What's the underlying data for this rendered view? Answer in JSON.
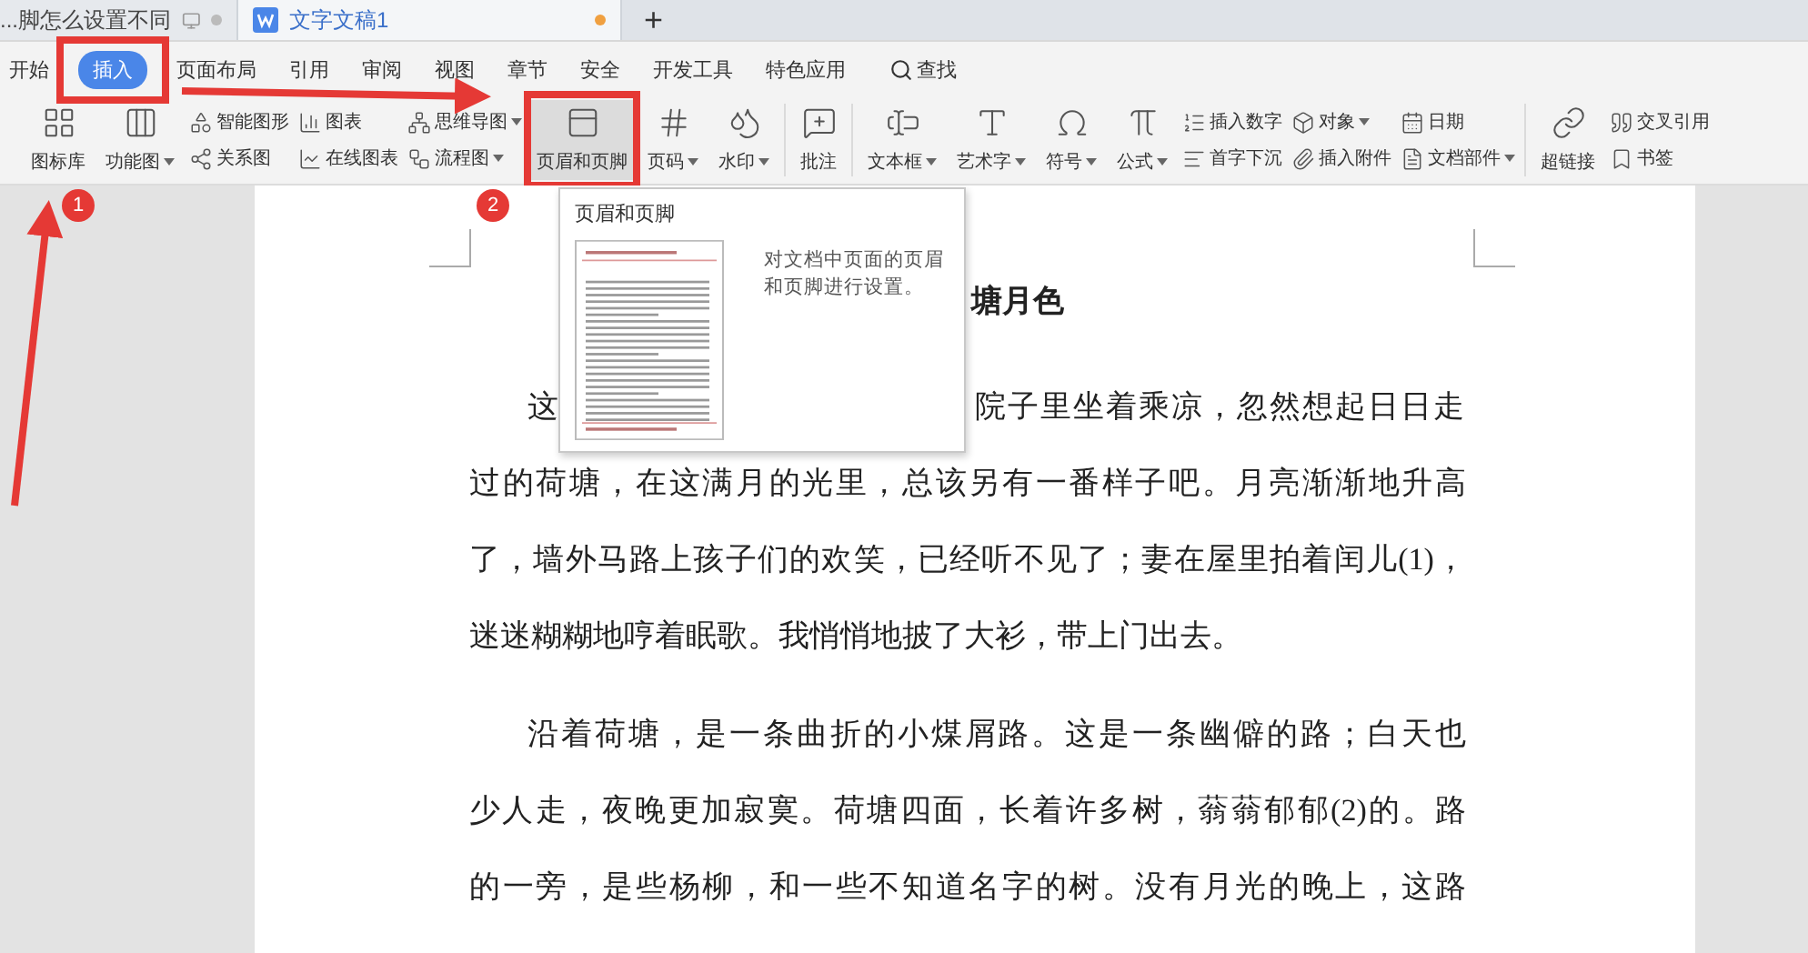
{
  "doc_tabs": [
    {
      "title": "...脚怎么设置不同",
      "selected": false,
      "modified": false
    },
    {
      "title": "文字文稿1",
      "selected": true,
      "modified": true
    }
  ],
  "new_tab": "+",
  "menu": [
    {
      "label": "开始",
      "selected": false
    },
    {
      "label": "插入",
      "selected": true
    },
    {
      "label": "页面布局",
      "selected": false
    },
    {
      "label": "引用",
      "selected": false
    },
    {
      "label": "审阅",
      "selected": false
    },
    {
      "label": "视图",
      "selected": false
    },
    {
      "label": "章节",
      "selected": false
    },
    {
      "label": "安全",
      "selected": false
    },
    {
      "label": "开发工具",
      "selected": false
    },
    {
      "label": "特色应用",
      "selected": false
    }
  ],
  "search": "查找",
  "ribbon": [
    {
      "kind": "large",
      "label": "图标库",
      "dropdown": false,
      "selected": false
    },
    {
      "kind": "large",
      "label": "功能图",
      "dropdown": true,
      "selected": false
    },
    {
      "kind": "stack",
      "items": [
        {
          "label": "智能图形",
          "dropdown": false
        },
        {
          "label": "关系图",
          "dropdown": false
        }
      ]
    },
    {
      "kind": "stack",
      "items": [
        {
          "label": "图表",
          "dropdown": false
        },
        {
          "label": "在线图表",
          "dropdown": false
        }
      ]
    },
    {
      "kind": "stack",
      "items": [
        {
          "label": "思维导图",
          "dropdown": true
        },
        {
          "label": "流程图",
          "dropdown": true
        }
      ]
    },
    {
      "kind": "large",
      "label": "页眉和页脚",
      "dropdown": false,
      "selected": true
    },
    {
      "kind": "large",
      "label": "页码",
      "dropdown": true,
      "selected": false
    },
    {
      "kind": "large",
      "label": "水印",
      "dropdown": true,
      "selected": false
    },
    {
      "kind": "large",
      "label": "批注",
      "dropdown": false,
      "selected": false
    },
    {
      "kind": "large",
      "label": "文本框",
      "dropdown": true,
      "selected": false
    },
    {
      "kind": "large",
      "label": "艺术字",
      "dropdown": true,
      "selected": false
    },
    {
      "kind": "large",
      "label": "符号",
      "dropdown": true,
      "selected": false
    },
    {
      "kind": "large",
      "label": "公式",
      "dropdown": true,
      "selected": false
    },
    {
      "kind": "stack",
      "items": [
        {
          "label": "插入数字",
          "dropdown": false
        },
        {
          "label": "首字下沉",
          "dropdown": false
        }
      ]
    },
    {
      "kind": "stack",
      "items": [
        {
          "label": "对象",
          "dropdown": true
        },
        {
          "label": "插入附件",
          "dropdown": false
        }
      ]
    },
    {
      "kind": "stack",
      "items": [
        {
          "label": "日期",
          "dropdown": false
        },
        {
          "label": "文档部件",
          "dropdown": true
        }
      ]
    },
    {
      "kind": "large",
      "label": "超链接",
      "dropdown": false,
      "selected": false
    },
    {
      "kind": "stack",
      "items": [
        {
          "label": "交叉引用",
          "dropdown": false
        },
        {
          "label": "书签",
          "dropdown": false
        }
      ]
    }
  ],
  "tooltip": {
    "title": "页眉和页脚",
    "description": "对文档中页面的页眉和页脚进行设置。"
  },
  "document": {
    "title": "塘月色",
    "paragraphs": [
      {
        "lines": [
          [
            "这",
            "院子里坐着乘凉，忽然想起日日走"
          ],
          [
            "过的荷塘，在这满月的光里，总该另有一番样子吧。月亮渐渐地升高"
          ],
          [
            "了，墙外马路上孩子们的欢笑，已经听不见了；妻在屋里拍着闰儿(1)，"
          ],
          [
            "迷迷糊糊地哼着眠歌。我悄悄地披了大衫，带上门出去。"
          ]
        ]
      },
      {
        "lines": [
          [
            "沿着荷塘，是一条曲折的小煤屑路。这是一条幽僻的路；白天也"
          ],
          [
            "少人走，夜晚更加寂寞。荷塘四面，长着许多树，蓊蓊郁郁(2)的。路"
          ],
          [
            "的一旁，是些杨柳，和一些不知道名字的树。没有月光的晚上，这路"
          ]
        ]
      }
    ]
  },
  "annotations": [
    {
      "label": "1"
    },
    {
      "label": "2"
    }
  ]
}
